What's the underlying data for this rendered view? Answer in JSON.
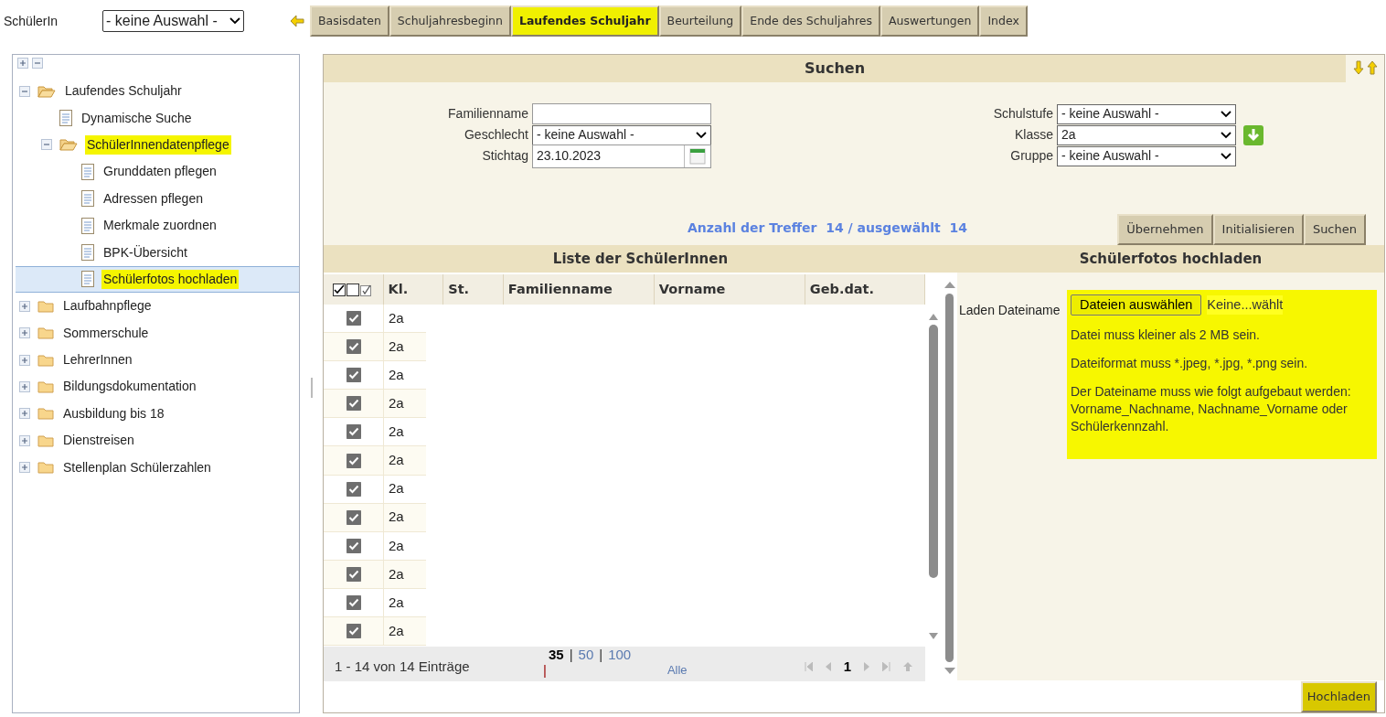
{
  "student_select": {
    "label": "SchülerIn",
    "value": "- keine Auswahl -"
  },
  "tabs": [
    {
      "label": "Basisdaten",
      "selected": false
    },
    {
      "label": "Schuljahresbeginn",
      "selected": false
    },
    {
      "label": "Laufendes Schuljahr",
      "selected": true
    },
    {
      "label": "Beurteilung",
      "selected": false
    },
    {
      "label": "Ende des Schuljahres",
      "selected": false
    },
    {
      "label": "Auswertungen",
      "selected": false
    },
    {
      "label": "Index",
      "selected": false
    }
  ],
  "tree": [
    {
      "kind": "folder",
      "label": "Laufendes Schuljahr",
      "expanded": true,
      "highlighted": false,
      "selected": false,
      "children": [
        {
          "kind": "page",
          "label": "Dynamische Suche",
          "highlighted": false,
          "selected": false
        },
        {
          "kind": "folder",
          "label": "SchülerInnendatenpflege",
          "expanded": true,
          "highlighted": true,
          "selected": false,
          "children": [
            {
              "kind": "page",
              "label": "Grunddaten pflegen",
              "highlighted": false,
              "selected": false
            },
            {
              "kind": "page",
              "label": "Adressen pflegen",
              "highlighted": false,
              "selected": false
            },
            {
              "kind": "page",
              "label": "Merkmale zuordnen",
              "highlighted": false,
              "selected": false
            },
            {
              "kind": "page",
              "label": "BPK-Übersicht",
              "highlighted": false,
              "selected": false
            },
            {
              "kind": "page",
              "label": "Schülerfotos hochladen",
              "highlighted": true,
              "selected": true
            }
          ]
        }
      ]
    },
    {
      "kind": "folder",
      "label": "Laufbahnpflege",
      "expanded": false,
      "highlighted": false,
      "selected": false
    },
    {
      "kind": "folder",
      "label": "Sommerschule",
      "expanded": false,
      "highlighted": false,
      "selected": false
    },
    {
      "kind": "folder",
      "label": "LehrerInnen",
      "expanded": false,
      "highlighted": false,
      "selected": false
    },
    {
      "kind": "folder",
      "label": "Bildungsdokumentation",
      "expanded": false,
      "highlighted": false,
      "selected": false
    },
    {
      "kind": "folder",
      "label": "Ausbildung bis 18",
      "expanded": false,
      "highlighted": false,
      "selected": false
    },
    {
      "kind": "folder",
      "label": "Dienstreisen",
      "expanded": false,
      "highlighted": false,
      "selected": false
    },
    {
      "kind": "folder",
      "label": "Stellenplan Schülerzahlen",
      "expanded": false,
      "highlighted": false,
      "selected": false
    }
  ],
  "search": {
    "title": "Suchen",
    "left_fields": [
      {
        "kind": "text",
        "label": "Familienname"
      },
      {
        "kind": "select",
        "label": "Geschlecht",
        "value": "- keine Auswahl -"
      },
      {
        "kind": "date",
        "label": "Stichtag",
        "value": "23.10.2023"
      }
    ],
    "right_fields": [
      {
        "kind": "select",
        "label": "Schulstufe",
        "value": "- keine Auswahl -"
      },
      {
        "kind": "select",
        "label": "Klasse",
        "value": "2a",
        "action": true
      },
      {
        "kind": "select",
        "label": "Gruppe",
        "value": "- keine Auswahl -"
      }
    ],
    "hits": "Anzahl der Treffer  14 / ausgewählt  14",
    "buttons": [
      "Übernehmen",
      "Initialisieren",
      "Suchen"
    ]
  },
  "list": {
    "title": "Liste der SchülerInnen",
    "columns": [
      "Kl.",
      "St.",
      "Familienname",
      "Vorname",
      "Geb.dat."
    ],
    "rows": [
      {
        "checked": true,
        "class": "2a"
      },
      {
        "checked": true,
        "class": "2a"
      },
      {
        "checked": true,
        "class": "2a"
      },
      {
        "checked": true,
        "class": "2a"
      },
      {
        "checked": true,
        "class": "2a"
      },
      {
        "checked": true,
        "class": "2a"
      },
      {
        "checked": true,
        "class": "2a"
      },
      {
        "checked": true,
        "class": "2a"
      },
      {
        "checked": true,
        "class": "2a"
      },
      {
        "checked": true,
        "class": "2a"
      },
      {
        "checked": true,
        "class": "2a"
      },
      {
        "checked": true,
        "class": "2a"
      }
    ],
    "range": "1 - 14 von 14 Einträge",
    "page_sizes": [
      {
        "label": "35",
        "selected": true,
        "separator": "|"
      },
      {
        "label": "50",
        "selected": false,
        "separator": "|"
      },
      {
        "label": "100",
        "selected": false,
        "separator": "|"
      },
      {
        "label": "Alle",
        "selected": false
      }
    ],
    "page": "1"
  },
  "upload": {
    "title": "Schülerfotos hochladen",
    "label": "Laden Dateiname",
    "button": "Dateien auswählen",
    "file_status": "Keine...wählt",
    "notes": [
      "Datei muss kleiner als 2 MB sein.",
      "Dateiformat muss *.jpeg, *.jpg, *.png sein.",
      "Der Dateiname muss wie folgt aufgebaut werden: Vorname_Nachname, Nachname_Vorname oder Schülerkennzahl."
    ],
    "submit": "Hochladen"
  }
}
